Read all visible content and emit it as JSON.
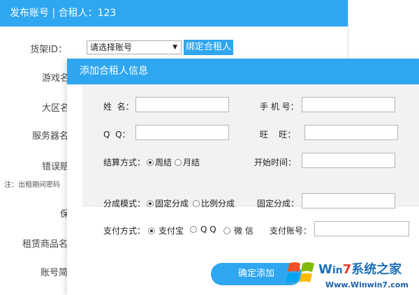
{
  "background_window": {
    "title": "发布账号 | 合租人：123",
    "shelf_id_label": "货架ID：",
    "select_value": "请选择账号",
    "bind_button": "绑定合租人",
    "labels": [
      "游戏名",
      "大区名",
      "服务器名",
      "错误赔",
      "保",
      "租赁商品名",
      "账号简"
    ],
    "note": "注：出租期间密码"
  },
  "dialog": {
    "title": "添加合租人信息",
    "name_label": "姓  名：",
    "phone_label": "手 机 号：",
    "qq_label": "Q  Q：",
    "wangwang_label": "旺    旺：",
    "settlement_label": "结算方式：",
    "settlement_options": [
      "周结",
      "月结"
    ],
    "start_time_label": "开始时间：",
    "share_mode_label": "分成模式：",
    "share_mode_options": [
      "固定分成",
      "比例分成"
    ],
    "fixed_share_label": "固定分成：",
    "payment_label": "支付方式：",
    "payment_options": [
      "支付宝",
      "Q Q",
      "微 信"
    ],
    "payment_account_label": "支付账号：",
    "confirm_button": "确定添加"
  },
  "watermark": {
    "brand_w": "W",
    "brand_in": "in",
    "brand_7": "7",
    "brand_rest": "系统之家",
    "url": "Www.Winwin7.com"
  },
  "colors": {
    "accent": "#2ea6f0",
    "panel_bg": "#f2f2f2"
  }
}
